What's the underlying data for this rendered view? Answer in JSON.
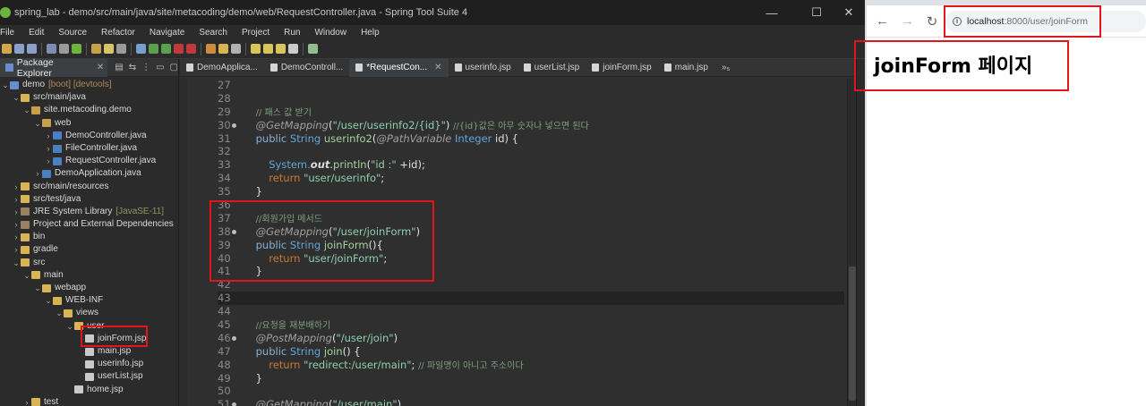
{
  "ide": {
    "window_title": "spring_lab - demo/src/main/java/site/metacoding/demo/web/RequestController.java - Spring Tool Suite 4",
    "window_controls": {
      "minimize": "—",
      "maximize": "☐",
      "close": "✕"
    },
    "menu": [
      "File",
      "Edit",
      "Source",
      "Refactor",
      "Navigate",
      "Search",
      "Project",
      "Run",
      "Window",
      "Help"
    ],
    "explorer": {
      "tab_label": "Package Explorer",
      "tree": [
        {
          "label": "demo",
          "deco": "[boot] [devtools]",
          "icon": "project-icon",
          "chev": "⌄",
          "indent": 0
        },
        {
          "label": "src/main/java",
          "icon": "source-folder-icon",
          "chev": "⌄",
          "indent": 1
        },
        {
          "label": "site.metacoding.demo",
          "icon": "package-icon",
          "chev": "⌄",
          "indent": 2
        },
        {
          "label": "web",
          "icon": "package-icon",
          "chev": "⌄",
          "indent": 3
        },
        {
          "label": "DemoController.java",
          "icon": "java-file-icon",
          "chev": "›",
          "indent": 4
        },
        {
          "label": "FileController.java",
          "icon": "java-file-icon",
          "chev": "›",
          "indent": 4
        },
        {
          "label": "RequestController.java",
          "icon": "java-file-icon",
          "chev": "›",
          "indent": 4
        },
        {
          "label": "DemoApplication.java",
          "icon": "java-file-icon",
          "chev": "›",
          "indent": 3
        },
        {
          "label": "src/main/resources",
          "icon": "source-folder-icon",
          "chev": "›",
          "indent": 1
        },
        {
          "label": "src/test/java",
          "icon": "source-folder-icon",
          "chev": "›",
          "indent": 1
        },
        {
          "label": "JRE System Library",
          "deco2": "[JavaSE-11]",
          "icon": "library-icon",
          "chev": "›",
          "indent": 1
        },
        {
          "label": "Project and External Dependencies",
          "icon": "library-icon",
          "chev": "›",
          "indent": 1
        },
        {
          "label": "bin",
          "icon": "folder-icon",
          "chev": "›",
          "indent": 1
        },
        {
          "label": "gradle",
          "icon": "folder-icon",
          "chev": "›",
          "indent": 1
        },
        {
          "label": "src",
          "icon": "folder-icon",
          "chev": "⌄",
          "indent": 1
        },
        {
          "label": "main",
          "icon": "folder-icon",
          "chev": "⌄",
          "indent": 2
        },
        {
          "label": "webapp",
          "icon": "folder-icon",
          "chev": "⌄",
          "indent": 3
        },
        {
          "label": "WEB-INF",
          "icon": "folder-icon",
          "chev": "⌄",
          "indent": 4
        },
        {
          "label": "views",
          "icon": "folder-icon",
          "chev": "⌄",
          "indent": 5
        },
        {
          "label": "user",
          "icon": "folder-icon",
          "chev": "⌄",
          "indent": 6
        },
        {
          "label": "joinForm.jsp",
          "icon": "jsp-file-icon",
          "chev": "",
          "indent": 7
        },
        {
          "label": "main.jsp",
          "icon": "jsp-file-icon",
          "chev": "",
          "indent": 7
        },
        {
          "label": "userinfo.jsp",
          "icon": "jsp-file-icon",
          "chev": "",
          "indent": 7
        },
        {
          "label": "userList.jsp",
          "icon": "jsp-file-icon",
          "chev": "",
          "indent": 7
        },
        {
          "label": "home.jsp",
          "icon": "jsp-file-icon",
          "chev": "",
          "indent": 6
        },
        {
          "label": "test",
          "icon": "folder-icon",
          "chev": "›",
          "indent": 2
        }
      ]
    },
    "editor_tabs": [
      {
        "label": "DemoApplica...",
        "active": false
      },
      {
        "label": "DemoControll...",
        "active": false
      },
      {
        "label": "*RequestCon...",
        "active": true
      },
      {
        "label": "userinfo.jsp",
        "active": false
      },
      {
        "label": "userList.jsp",
        "active": false
      },
      {
        "label": "joinForm.jsp",
        "active": false
      },
      {
        "label": "main.jsp",
        "active": false
      }
    ],
    "editor_overflow": "»₅",
    "code_lines": [
      {
        "n": "27",
        "t": []
      },
      {
        "n": "28",
        "t": []
      },
      {
        "n": "29",
        "t": [
          [
            "plain",
            "    "
          ],
          [
            "cmt",
            "// 패스 값 받기"
          ]
        ]
      },
      {
        "n": "30",
        "bp": true,
        "t": [
          [
            "plain",
            "    "
          ],
          [
            "anno",
            "@GetMapping"
          ],
          [
            "plain",
            "("
          ],
          [
            "str",
            "\"/user/userinfo2/{id}\""
          ],
          [
            "plain",
            ") "
          ],
          [
            "cmt",
            "//{id}값은 아무 숫자나 넣으면 된다"
          ]
        ]
      },
      {
        "n": "31",
        "t": [
          [
            "plain",
            "    "
          ],
          [
            "kw2",
            "public "
          ],
          [
            "typ",
            "String "
          ],
          [
            "mth",
            "userinfo2"
          ],
          [
            "plain",
            "("
          ],
          [
            "anno",
            "@PathVariable "
          ],
          [
            "typ",
            "Integer "
          ],
          [
            "plain",
            "id) {"
          ]
        ]
      },
      {
        "n": "32",
        "t": []
      },
      {
        "n": "33",
        "t": [
          [
            "plain",
            "        "
          ],
          [
            "sys",
            "System."
          ],
          [
            "out",
            "out"
          ],
          [
            "plain",
            "."
          ],
          [
            "mth",
            "println"
          ],
          [
            "plain",
            "("
          ],
          [
            "str",
            "\"id :\""
          ],
          [
            "plain",
            " +id);"
          ]
        ]
      },
      {
        "n": "34",
        "t": [
          [
            "plain",
            "        "
          ],
          [
            "kw",
            "return "
          ],
          [
            "str",
            "\"user/userinfo\""
          ],
          [
            "plain",
            ";"
          ]
        ]
      },
      {
        "n": "35",
        "t": [
          [
            "plain",
            "    }"
          ]
        ]
      },
      {
        "n": "36",
        "t": []
      },
      {
        "n": "37",
        "t": [
          [
            "plain",
            "    "
          ],
          [
            "cmt",
            "//회원가입 메서드"
          ]
        ]
      },
      {
        "n": "38",
        "bp": true,
        "t": [
          [
            "plain",
            "    "
          ],
          [
            "anno",
            "@GetMapping"
          ],
          [
            "plain",
            "("
          ],
          [
            "str",
            "\"/user/joinForm\""
          ],
          [
            "plain",
            ")"
          ]
        ]
      },
      {
        "n": "39",
        "t": [
          [
            "plain",
            "    "
          ],
          [
            "kw2",
            "public "
          ],
          [
            "typ",
            "String "
          ],
          [
            "mth",
            "joinForm"
          ],
          [
            "plain",
            "(){"
          ]
        ]
      },
      {
        "n": "40",
        "t": [
          [
            "plain",
            "        "
          ],
          [
            "kw",
            "return "
          ],
          [
            "str",
            "\"user/joinForm\""
          ],
          [
            "plain",
            ";"
          ]
        ]
      },
      {
        "n": "41",
        "t": [
          [
            "plain",
            "    }"
          ]
        ]
      },
      {
        "n": "42",
        "t": []
      },
      {
        "n": "43",
        "hl": true,
        "t": []
      },
      {
        "n": "44",
        "t": []
      },
      {
        "n": "45",
        "t": [
          [
            "plain",
            "    "
          ],
          [
            "cmt",
            "//요청을 재분배하기"
          ]
        ]
      },
      {
        "n": "46",
        "bp": true,
        "t": [
          [
            "plain",
            "    "
          ],
          [
            "anno",
            "@PostMapping"
          ],
          [
            "plain",
            "("
          ],
          [
            "str",
            "\"/user/join\""
          ],
          [
            "plain",
            ")"
          ]
        ]
      },
      {
        "n": "47",
        "t": [
          [
            "plain",
            "    "
          ],
          [
            "kw2",
            "public "
          ],
          [
            "typ",
            "String "
          ],
          [
            "mth",
            "join"
          ],
          [
            "plain",
            "() {"
          ]
        ]
      },
      {
        "n": "48",
        "t": [
          [
            "plain",
            "        "
          ],
          [
            "kw",
            "return "
          ],
          [
            "str",
            "\"redirect:/user/main\""
          ],
          [
            "plain",
            "; "
          ],
          [
            "cmt",
            "// 파일명이 아니고 주소이다"
          ]
        ]
      },
      {
        "n": "49",
        "t": [
          [
            "plain",
            "    }"
          ]
        ]
      },
      {
        "n": "50",
        "t": []
      },
      {
        "n": "51",
        "bp": true,
        "t": [
          [
            "plain",
            "    "
          ],
          [
            "anno",
            "@GetMapping"
          ],
          [
            "plain",
            "("
          ],
          [
            "str",
            "\"/user/main\""
          ],
          [
            "plain",
            ")"
          ]
        ]
      }
    ]
  },
  "browser": {
    "url_host": "localhost",
    "url_rest": ":8000/user/joinForm",
    "page_heading": "joinForm 페이지"
  },
  "colors": {
    "highlight_box": "#e2151b",
    "ide_bg": "#2b2b2b",
    "editor_bg": "#2f2f2f"
  }
}
